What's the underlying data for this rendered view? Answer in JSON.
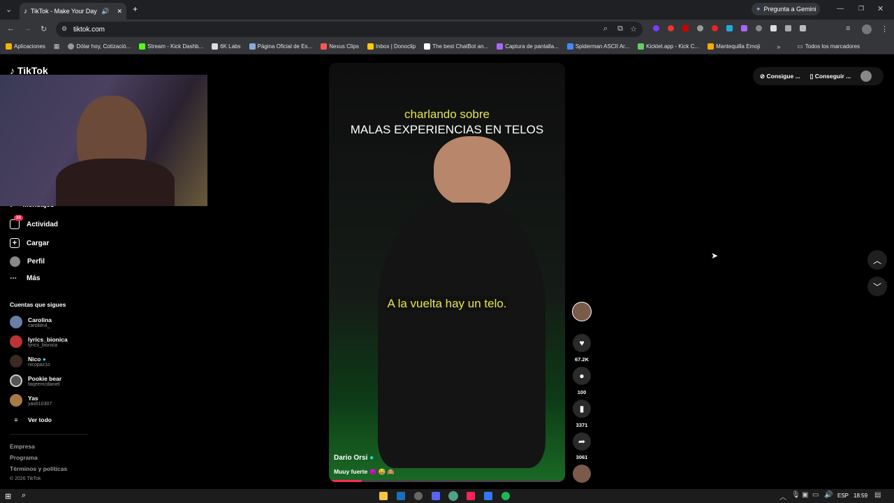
{
  "browser": {
    "tab_title": "TikTok - Make Your Day",
    "new_tab": "+",
    "gemini": "Pregunta a Gemini",
    "url": "tiktok.com",
    "bookmarks": [
      "Aplicaciones",
      "Dólar hoy, Cotizació...",
      "Stream - Kick Dashb...",
      "6K Labs",
      "Página Oficial de Es...",
      "Nexus Clips",
      "Inbox | Donoclip",
      "The best ChatBot an...",
      "Captura de pantalla...",
      "Spiderman ASCII Ar...",
      "Kicklet.app - Kick C...",
      "Mantequilla Emoji"
    ],
    "all_bookmarks": "Todos los marcadores"
  },
  "sidebar": {
    "logo": "TikTok",
    "nav": [
      {
        "label": "Mensajes"
      },
      {
        "label": "Actividad",
        "badge": "16"
      },
      {
        "label": "Cargar"
      },
      {
        "label": "Perfil"
      },
      {
        "label": "Más"
      }
    ],
    "following_title": "Cuentas que sigues",
    "following": [
      {
        "name": "Carolina",
        "handle": "caroliiin4_"
      },
      {
        "name": "lyrics_bionica",
        "handle": "lyrics_bionica"
      },
      {
        "name": "Nico",
        "handle": "nicopaz1o"
      },
      {
        "name": "Pookie bear",
        "handle": "faqeemcdaniel"
      },
      {
        "name": "Yas",
        "handle": "yas610307"
      }
    ],
    "see_all": "Ver todo",
    "footer": [
      "Empresa",
      "Programa",
      "Términos y políticas",
      "© 2026 TikTok"
    ]
  },
  "header": {
    "btn1": "Consigue ...",
    "btn2": "Conseguir ..."
  },
  "video": {
    "caption_top": "charlando sobre",
    "caption_main": "MALAS EXPERIENCIAS EN TELOS",
    "subtitle": "A la vuelta hay un telo.",
    "author": "Dario Orsi",
    "description": "Muuy fuerte 😈 😅 🙈",
    "likes": "67.2K",
    "comments": "100",
    "saves": "3371",
    "shares": "3061"
  },
  "taskbar": {
    "lang": "ESP",
    "time": "18:59"
  },
  "colors": {
    "accent": "#fe2c55",
    "caption_yellow": "#e6e64a",
    "verified": "#20d5ec"
  }
}
